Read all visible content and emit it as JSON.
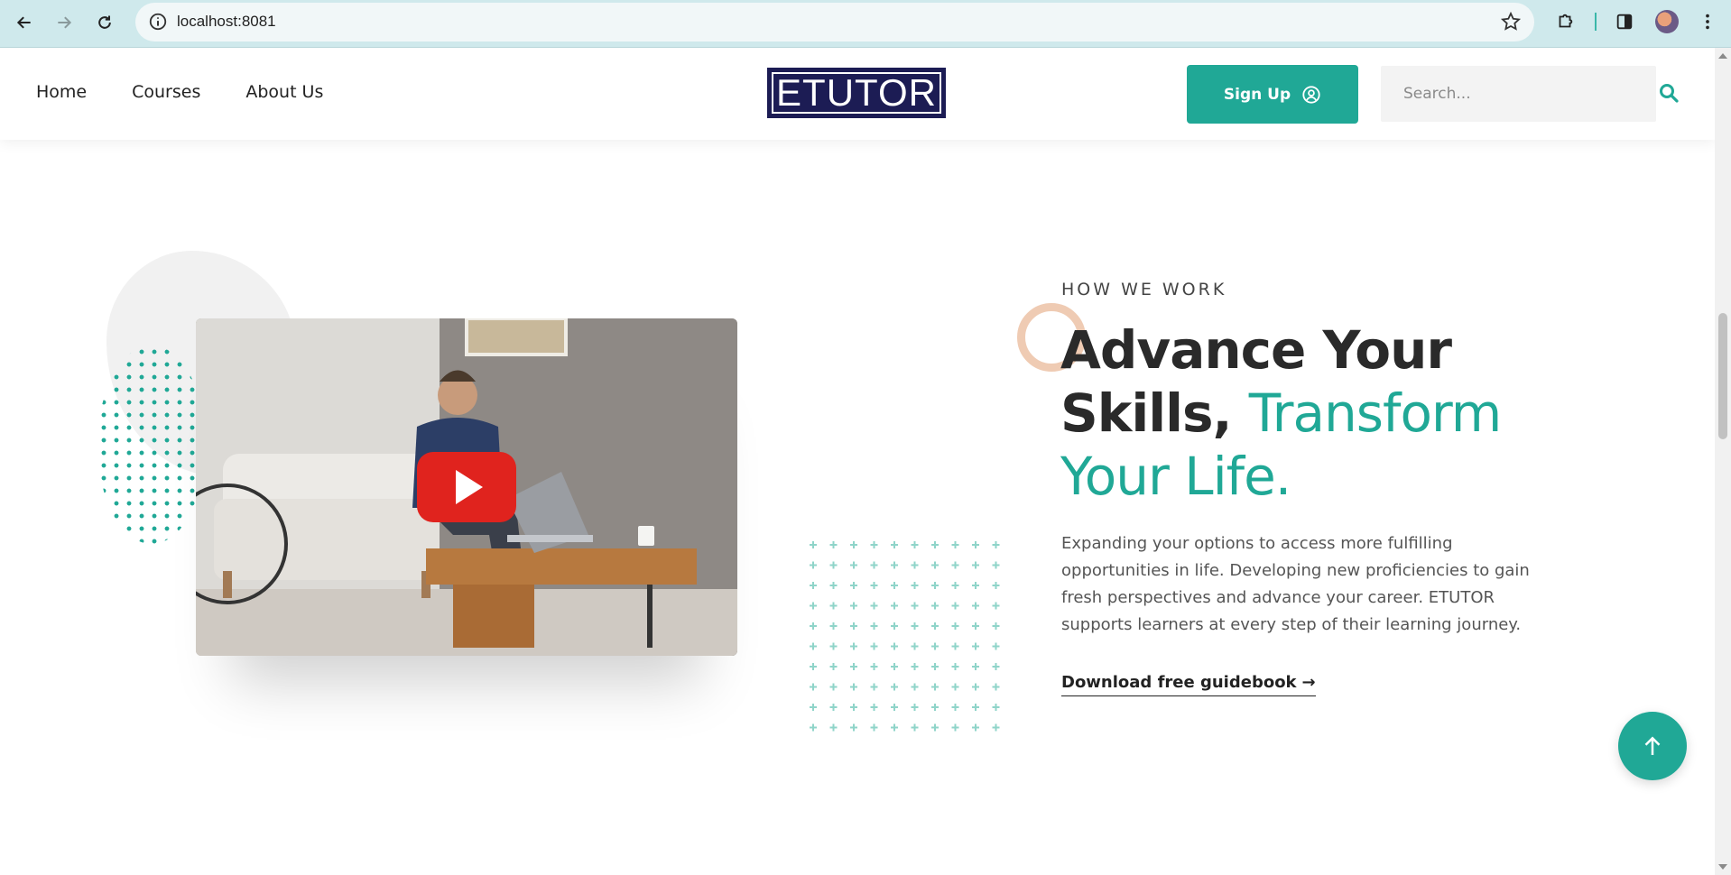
{
  "browser": {
    "url": "localhost:8081"
  },
  "header": {
    "menu": [
      "Home",
      "Courses",
      "About Us"
    ],
    "logo_text": "ETUTOR",
    "signup_label": "Sign Up",
    "search_placeholder": "Search..."
  },
  "hero": {
    "eyebrow": "HOW WE WORK",
    "headline_part1": "Advance Your Skills,",
    "headline_part2": "Transform Your Life.",
    "paragraph": "Expanding your options to access more fulfilling opportunities in life. Developing new proficiencies to gain fresh perspectives and advance your career. ETUTOR supports learners at every step of their learning journey.",
    "link_label": "Download free guidebook",
    "link_arrow": "→"
  },
  "colors": {
    "accent": "#20a896",
    "ring": "#efcbb3",
    "logo_bg": "#1c1c54"
  }
}
